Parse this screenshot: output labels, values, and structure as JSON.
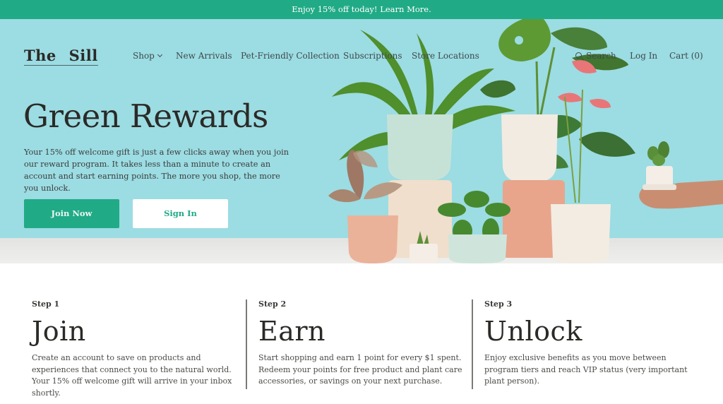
{
  "promo": {
    "text": "Enjoy 15% off today! Learn More."
  },
  "header": {
    "logo": "The Sill",
    "nav": [
      {
        "label": "Shop",
        "has_dropdown": true
      },
      {
        "label": "New Arrivals"
      },
      {
        "label": "Pet-Friendly Collection"
      },
      {
        "label": "Subscriptions"
      },
      {
        "label": "Store Locations"
      }
    ],
    "utility": {
      "search_label": "Search",
      "login_label": "Log In",
      "cart_label": "Cart (0)"
    }
  },
  "hero": {
    "title": "Green Rewards",
    "description": "Your 15% off welcome gift is just a few clicks away when you join our reward program. It takes less than a minute to create an account and start earning points. The more you shop, the more you unlock.",
    "join_button": "Join Now",
    "signin_button": "Sign In",
    "image_alt": "Potted plants on a table against a light blue background"
  },
  "steps": [
    {
      "label": "Step 1",
      "title": "Join",
      "description": "Create an account to save on products and experiences that connect you to the natural world. Your 15% off welcome gift will arrive in your inbox shortly."
    },
    {
      "label": "Step 2",
      "title": "Earn",
      "description": "Start shopping and earn 1 point for every $1 spent. Redeem your points for free product and plant care accessories, or savings on your next purchase."
    },
    {
      "label": "Step 3",
      "title": "Unlock",
      "description": "Enjoy exclusive benefits as you move between program tiers and reach VIP status (very important plant person)."
    }
  ],
  "colors": {
    "brand_green": "#21aa86",
    "hero_bg": "#9cdce3",
    "text_dark": "#2b2a27"
  }
}
